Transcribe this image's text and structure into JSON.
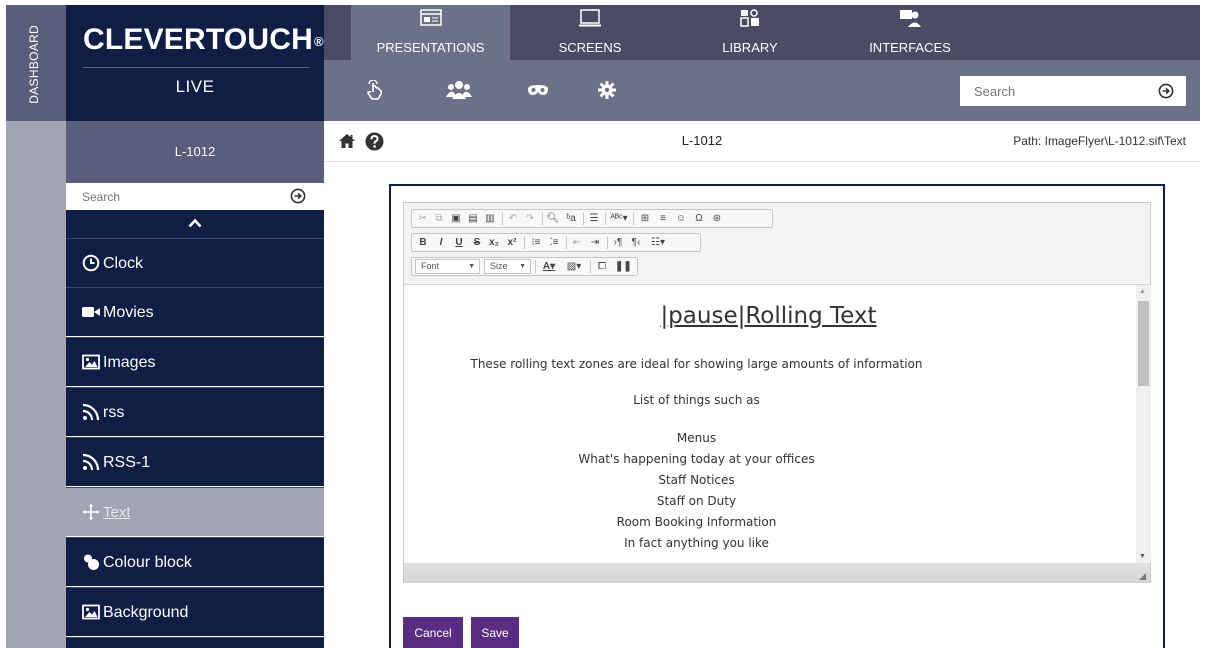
{
  "rail": {
    "label": "DASHBOARD"
  },
  "brand": {
    "name": "CLEVERTOUCH",
    "mark": "®",
    "sub": "LIVE"
  },
  "topnav": {
    "tabs": [
      {
        "label": "PRESENTATIONS",
        "icon": "presentation-icon",
        "active": true
      },
      {
        "label": "SCREENS",
        "icon": "monitor-icon",
        "active": false
      },
      {
        "label": "LIBRARY",
        "icon": "library-icon",
        "active": false
      },
      {
        "label": "INTERFACES",
        "icon": "interfaces-icon",
        "active": false
      }
    ],
    "toolbar_icons": [
      "touch-icon",
      "users-icon",
      "mask-icon",
      "gear-icon"
    ],
    "search_placeholder": "Search"
  },
  "sidebar": {
    "title": "L-1012",
    "search_placeholder": "Search",
    "items": [
      {
        "label": "Clock",
        "icon": "clock-icon"
      },
      {
        "label": "Movies",
        "icon": "video-camera-icon"
      },
      {
        "label": "Images",
        "icon": "image-icon"
      },
      {
        "label": "rss",
        "icon": "rss-icon"
      },
      {
        "label": "RSS-1",
        "icon": "rss-icon"
      },
      {
        "label": "Text",
        "icon": "move-icon",
        "active": true
      },
      {
        "label": "Colour block",
        "icon": "colour-blobs-icon"
      },
      {
        "label": "Background",
        "icon": "image-icon"
      }
    ]
  },
  "main": {
    "title": "L-1012",
    "path": "Path: ImageFlyer\\L-1012.sif\\Text"
  },
  "editor": {
    "font_label": "Font",
    "size_label": "Size",
    "heading": "|pause|Rolling Text",
    "lines": [
      "These rolling text zones are ideal for showing large amounts of information",
      "List of things such as",
      "Menus",
      "What's happening today at your offices",
      "Staff Notices",
      "Staff on Duty",
      "Room Booking Information",
      "In fact anything you like"
    ]
  },
  "actions": {
    "cancel": "Cancel",
    "save": "Save"
  },
  "colors": {
    "navy": "#101d44",
    "slate": "#4a4c66",
    "accent": "#5a2d82",
    "muted": "#a3a4b3"
  }
}
